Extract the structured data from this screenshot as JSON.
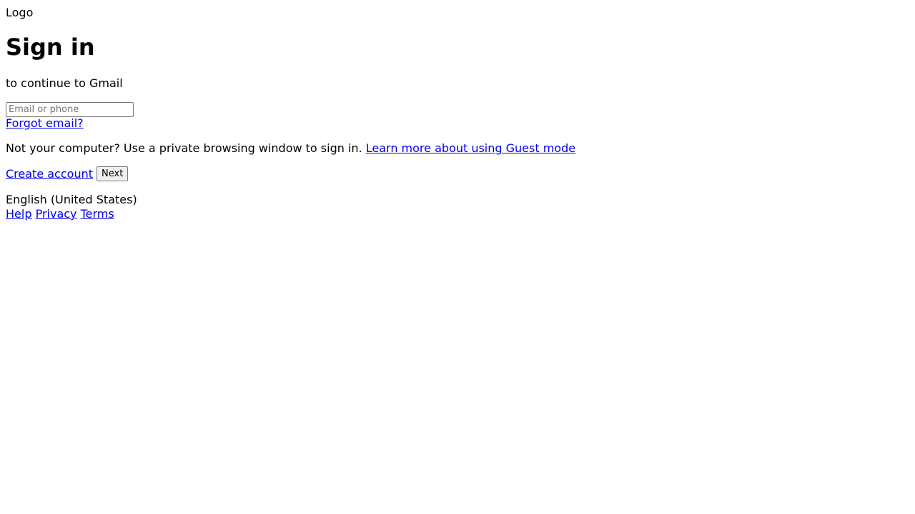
{
  "logo": {
    "alt_text": "Logo",
    "icon": "broken-image-icon"
  },
  "heading": {
    "title": "Sign in",
    "subtitle": "to continue to Gmail"
  },
  "form": {
    "email_placeholder": "Email or phone",
    "email_value": "",
    "forgot_email_label": "Forgot email?"
  },
  "notice": {
    "text": "Not your computer? Use a private browsing window to sign in.",
    "learn_more_label": "Learn more about using Guest mode"
  },
  "actions": {
    "create_account_label": "Create account",
    "next_label": "Next"
  },
  "footer": {
    "language": "English (United States)",
    "links": [
      "Help",
      "Privacy",
      "Terms"
    ]
  },
  "colors": {
    "link": "#0000ee",
    "text": "#000000",
    "background": "#ffffff"
  }
}
